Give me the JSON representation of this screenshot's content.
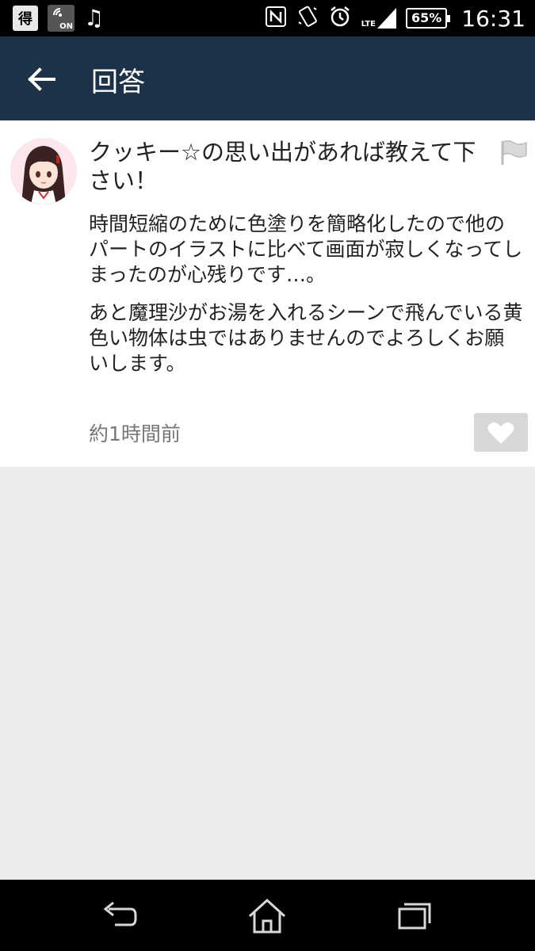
{
  "status_bar": {
    "toku_label": "得",
    "on_label": "ON",
    "music_icon": "♫",
    "battery": "65%",
    "time": "16:31",
    "network_label": "LTE"
  },
  "app_bar": {
    "title": "回答",
    "background_color": "#1b3249"
  },
  "answer": {
    "question": "クッキー☆の思い出があれば教えて下さい！",
    "paragraphs": [
      "時間短縮のために色塗りを簡略化したので他のパートのイラストに比べて画面が寂しくなってしまったのが心残りです…。",
      "あと魔理沙がお湯を入れるシーンで飛んでいる黄色い物体は虫ではありませんのでよろしくお願いします。"
    ],
    "timestamp": "約1時間前"
  },
  "icons": {
    "back": "arrow-left-icon",
    "flag": "flag-icon",
    "like": "heart-icon",
    "nav_back": "back-icon",
    "nav_home": "home-icon",
    "nav_recents": "recents-icon"
  }
}
